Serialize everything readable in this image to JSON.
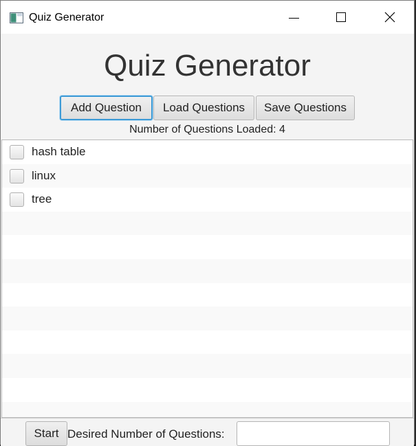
{
  "window": {
    "title": "Quiz Generator"
  },
  "header": {
    "heading": "Quiz Generator"
  },
  "toolbar": {
    "add_label": "Add Question",
    "load_label": "Load Questions",
    "save_label": "Save Questions"
  },
  "status": {
    "count_text": "Number of Questions Loaded: 4"
  },
  "topics": [
    {
      "label": "hash table",
      "checked": false
    },
    {
      "label": "linux",
      "checked": false
    },
    {
      "label": "tree",
      "checked": false
    }
  ],
  "footer": {
    "start_label": "Start",
    "desired_label": "Desired Number of Questions:",
    "desired_value": "",
    "desired_placeholder": ""
  },
  "colors": {
    "focus_border": "#3c9ad6",
    "heading_text": "#333333",
    "window_bg": "#f4f4f4"
  },
  "icons": {
    "app": "app-window-icon",
    "minimize": "minimize-icon",
    "maximize": "maximize-icon",
    "close": "close-icon"
  }
}
